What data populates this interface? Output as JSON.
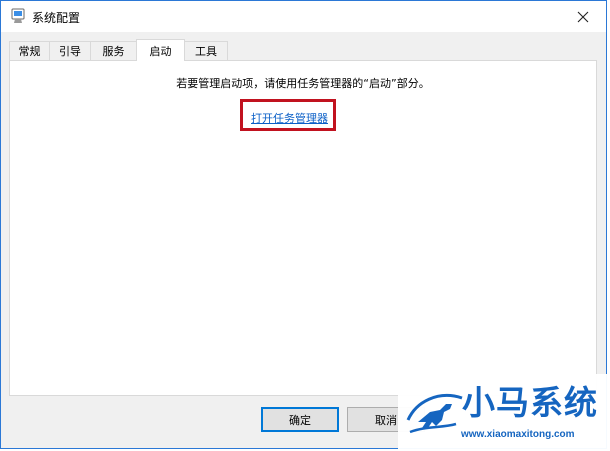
{
  "window": {
    "title": "系统配置"
  },
  "tabs": [
    {
      "label": "常规"
    },
    {
      "label": "引导"
    },
    {
      "label": "服务"
    },
    {
      "label": "启动"
    },
    {
      "label": "工具"
    }
  ],
  "active_tab": "启动",
  "startup": {
    "message": "若要管理启动项，请使用任务管理器的“启动”部分。",
    "link": "打开任务管理器"
  },
  "buttons": {
    "ok": "确定",
    "cancel": "取消"
  },
  "watermark": {
    "brand": "小马系统",
    "url": "www.xiaomaxitong.com"
  },
  "colors": {
    "accent": "#0078d7",
    "link": "#0a5fc7",
    "highlight": "#c1121f",
    "watermark": "#1565c0"
  }
}
